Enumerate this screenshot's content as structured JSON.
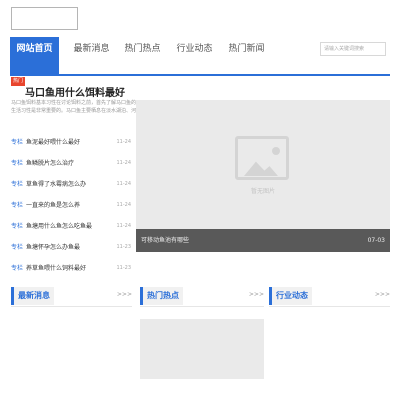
{
  "nav": {
    "tabs": [
      {
        "label": "网站首页",
        "active": true
      },
      {
        "label": "最新消息"
      },
      {
        "label": "热门热点"
      },
      {
        "label": "行业动态"
      },
      {
        "label": "热门新闻"
      }
    ],
    "search_placeholder": "请输入关键词搜索"
  },
  "featured": {
    "badge": "热门",
    "title": "马口鱼用什么饵料最好",
    "desc": "马口鱼饵料基本习性在讨论饵料之前，首先了解马口鱼的生活习性是非常重要的。马口鱼主要栖息在淡水湖泊、河流及水库……"
  },
  "list": [
    {
      "tag": "专栏",
      "title": "鱼泥最好喂什么最好",
      "date": "11-24"
    },
    {
      "tag": "专栏",
      "title": "鱼鳞脱片怎么治疗",
      "date": "11-24"
    },
    {
      "tag": "专栏",
      "title": "草鱼得了水霉病怎么办",
      "date": "11-24"
    },
    {
      "tag": "专栏",
      "title": "一直来的鱼是怎么养",
      "date": "11-24"
    },
    {
      "tag": "专栏",
      "title": "鱼塘用什么鱼怎么吃鱼最",
      "date": "11-24"
    },
    {
      "tag": "专栏",
      "title": "鱼塘怀孕怎么办鱼最",
      "date": "11-23"
    },
    {
      "tag": "专栏",
      "title": "养草鱼喂什么饲料最好",
      "date": "11-23"
    }
  ],
  "image_card": {
    "placeholder_text": "暂无图片",
    "caption": "可移动鱼池有哪些",
    "date": "07-03"
  },
  "columns": [
    {
      "label": "最新消息",
      "more": ">>>"
    },
    {
      "label": "热门热点",
      "more": ">>>"
    },
    {
      "label": "行业动态",
      "more": ">>>"
    }
  ],
  "colors": {
    "accent": "#2b6fd8",
    "badge": "#e8452d"
  }
}
